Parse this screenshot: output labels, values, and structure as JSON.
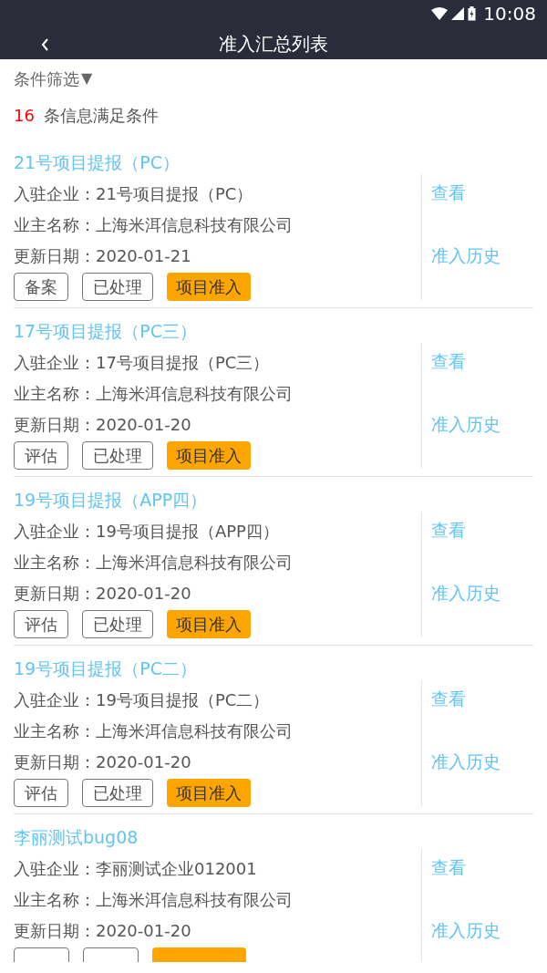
{
  "status_bar": {
    "time": "10:08"
  },
  "header": {
    "title": "准入汇总列表"
  },
  "filter": {
    "label": "条件筛选",
    "caret": "▼"
  },
  "summary": {
    "count": "16",
    "text": "条信息满足条件"
  },
  "items": [
    {
      "title": "21号项目提报（PC）",
      "fields": [
        "入驻企业：21号项目提报（PC）",
        "业主名称：上海米洱信息科技有限公司",
        "更新日期：2020-01-21"
      ],
      "tags": [
        {
          "label": "备案",
          "kind": "outline"
        },
        {
          "label": "已处理",
          "kind": "outline"
        },
        {
          "label": "项目准入",
          "kind": "filled"
        }
      ],
      "actions": [
        "查看",
        "准入历史"
      ]
    },
    {
      "title": "17号项目提报（PC三）",
      "fields": [
        "入驻企业：17号项目提报（PC三）",
        "业主名称：上海米洱信息科技有限公司",
        "更新日期：2020-01-20"
      ],
      "tags": [
        {
          "label": "评估",
          "kind": "outline"
        },
        {
          "label": "已处理",
          "kind": "outline"
        },
        {
          "label": "项目准入",
          "kind": "filled"
        }
      ],
      "actions": [
        "查看",
        "准入历史"
      ]
    },
    {
      "title": "19号项目提报（APP四）",
      "fields": [
        "入驻企业：19号项目提报（APP四）",
        "业主名称：上海米洱信息科技有限公司",
        "更新日期：2020-01-20"
      ],
      "tags": [
        {
          "label": "评估",
          "kind": "outline"
        },
        {
          "label": "已处理",
          "kind": "outline"
        },
        {
          "label": "项目准入",
          "kind": "filled"
        }
      ],
      "actions": [
        "查看",
        "准入历史"
      ]
    },
    {
      "title": "19号项目提报（PC二）",
      "fields": [
        "入驻企业：19号项目提报（PC二）",
        "业主名称：上海米洱信息科技有限公司",
        "更新日期：2020-01-20"
      ],
      "tags": [
        {
          "label": "评估",
          "kind": "outline"
        },
        {
          "label": "已处理",
          "kind": "outline"
        },
        {
          "label": "项目准入",
          "kind": "filled"
        }
      ],
      "actions": [
        "查看",
        "准入历史"
      ]
    },
    {
      "title": "李丽测试bug08",
      "fields": [
        "入驻企业：李丽测试企业012001",
        "业主名称：上海米洱信息科技有限公司",
        "更新日期：2020-01-20"
      ],
      "tags": [
        {
          "kind": "outline"
        },
        {
          "kind": "outline"
        },
        {
          "kind": "filled"
        }
      ],
      "actions": [
        "查看",
        "准入历史"
      ]
    }
  ]
}
